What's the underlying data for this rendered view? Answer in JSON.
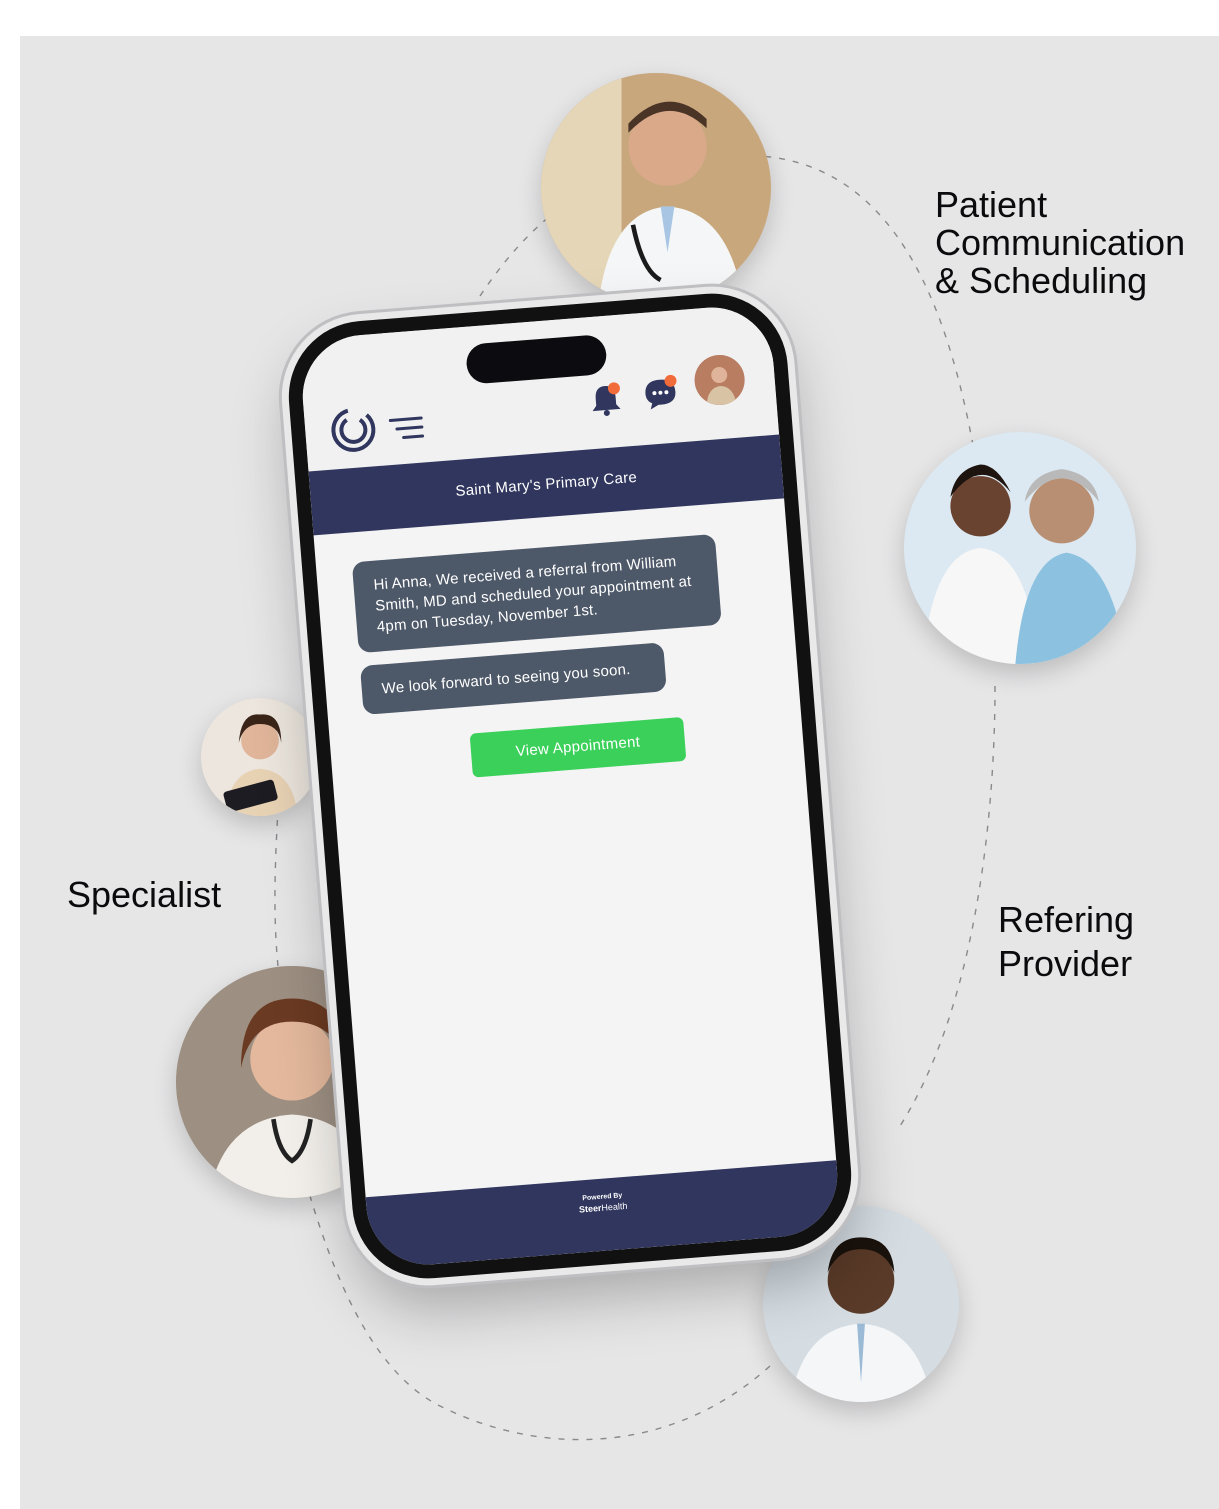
{
  "labels": {
    "patient": [
      "Patient",
      "Communication",
      "& Scheduling"
    ],
    "specialist": "Specialist",
    "referring": [
      "Refering",
      "Provider"
    ]
  },
  "phone": {
    "clinic_name": "Saint Mary's Primary Care",
    "messages": [
      "Hi Anna, We received a referral from William Smith, MD and scheduled your appointment at 4pm on Tuesday, November 1st.",
      "We look forward to seeing you soon."
    ],
    "view_button": "View Appointment",
    "powered_by": "Powered By",
    "brand": {
      "bold": "Steer",
      "light": "Health"
    },
    "icons": [
      "logo-icon",
      "menu-icon",
      "bell-icon",
      "chat-icon",
      "user-avatar"
    ]
  },
  "colors": {
    "header_navy": "#30365e",
    "bubble": "#4d5868",
    "button_green": "#3bd05a",
    "notification_dot": "#f26b3a",
    "background": "#e6e6e7"
  }
}
